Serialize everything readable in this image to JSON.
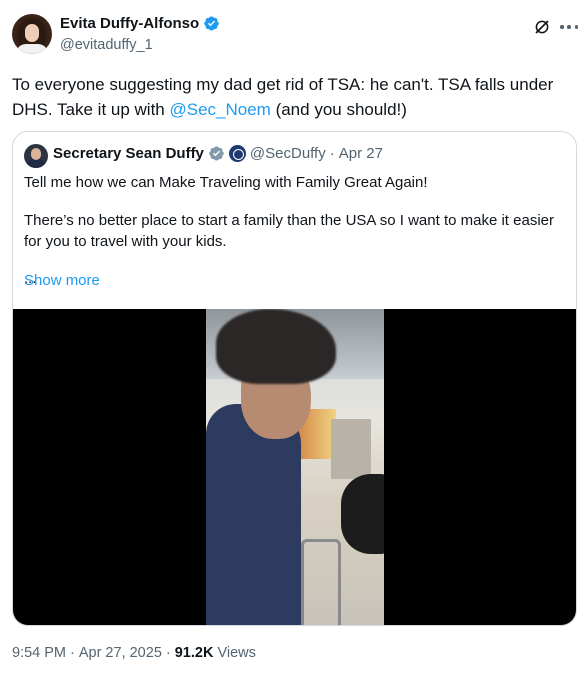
{
  "author": {
    "display_name": "Evita Duffy-Alfonso",
    "handle": "@evitaduffy_1"
  },
  "tweet": {
    "text_before": "To everyone suggesting my dad get rid of TSA: he can't. TSA falls under DHS. Take it up with ",
    "mention": "@Sec_Noem",
    "text_after": " (and you should!)"
  },
  "quote": {
    "display_name": "Secretary Sean Duffy",
    "handle": "@SecDuffy",
    "separator": "·",
    "date": "Apr 27",
    "paragraph1": "Tell me how we can Make Traveling with Family Great Again!",
    "paragraph2": "There’s no better place to start a family than the USA so I want to make it easier for you to travel with your kids.",
    "ellipsis": "...",
    "show_more": "Show more"
  },
  "meta": {
    "time": "9:54 PM",
    "separator1": "·",
    "date": "Apr 27, 2025",
    "separator2": "·",
    "views_count": "91.2K",
    "views_label": "Views"
  },
  "icons": {
    "verified": "verified-badge-icon",
    "gov": "government-badge-icon",
    "grok": "grok-icon",
    "more": "more-options-icon"
  },
  "colors": {
    "accent": "#1d9bf0",
    "text": "#0f1419",
    "secondary": "#536471",
    "border": "#cfd9de",
    "gov_badge": "#829aab"
  }
}
